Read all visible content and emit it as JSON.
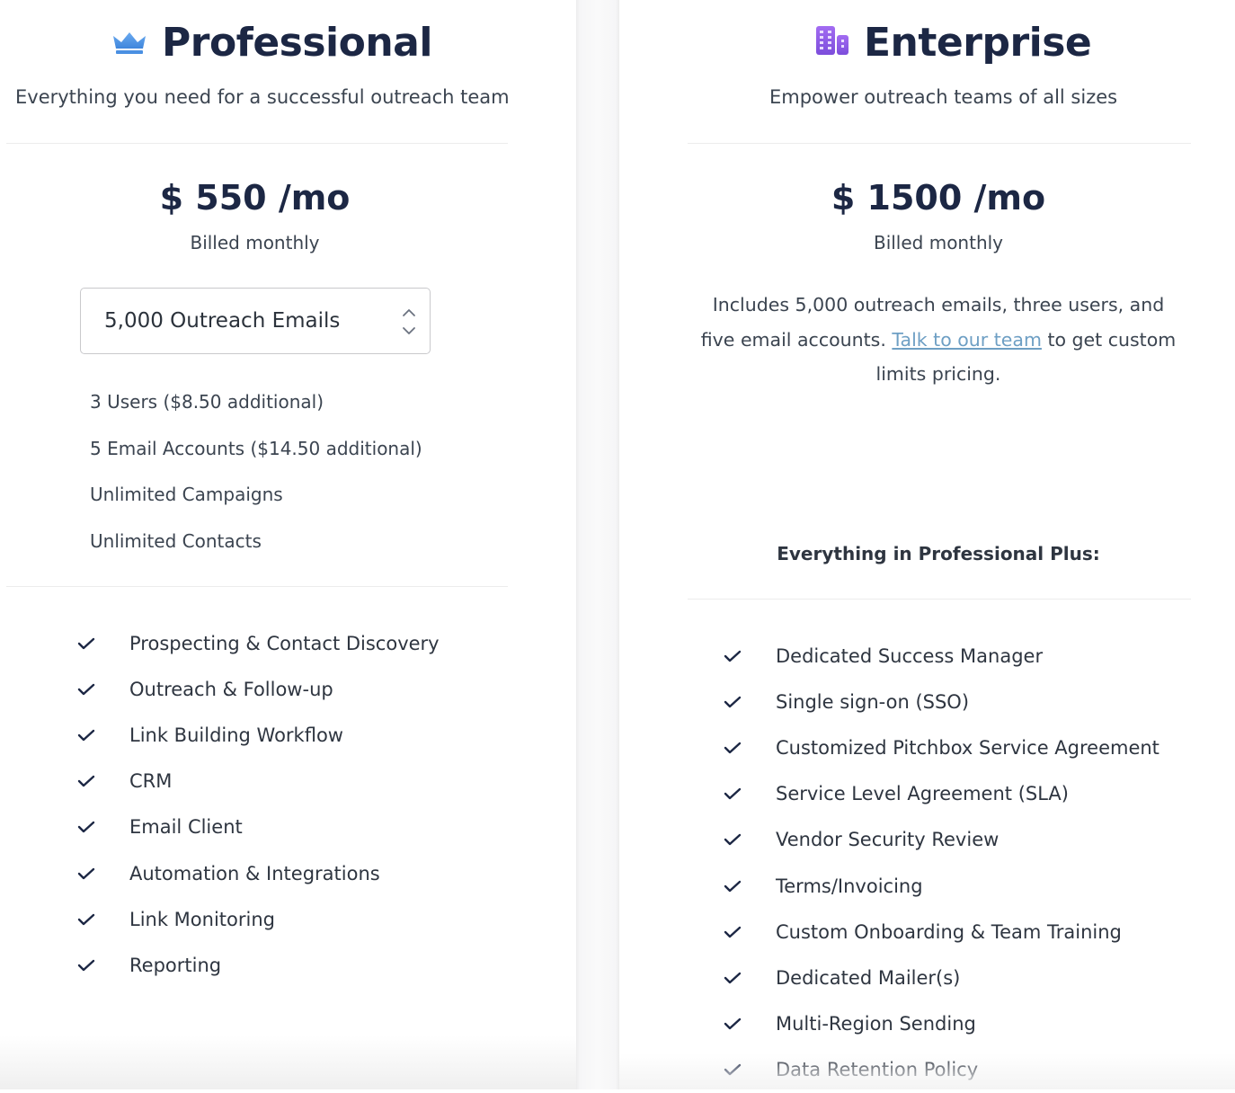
{
  "professional": {
    "icon": "crown-icon",
    "title": "Professional",
    "subtitle": "Everything you need for a successful outreach team",
    "price": "$ 550 /mo",
    "billing": "Billed monthly",
    "email_select": {
      "selected": "5,000 Outreach Emails"
    },
    "limits": [
      "3 Users ($8.50 additional)",
      "5 Email Accounts ($14.50 additional)",
      "Unlimited Campaigns",
      "Unlimited Contacts"
    ],
    "features": [
      "Prospecting & Contact Discovery",
      "Outreach & Follow-up",
      "Link Building Workflow",
      "CRM",
      "Email Client",
      "Automation & Integrations",
      "Link Monitoring",
      "Reporting"
    ]
  },
  "enterprise": {
    "icon": "building-icon",
    "title": "Enterprise",
    "subtitle": "Empower outreach teams of all sizes",
    "price": "$ 1500 /mo",
    "billing": "Billed monthly",
    "description": {
      "before_link": "Includes 5,000 outreach emails, three users, and five email accounts. ",
      "link_text": "Talk to our team",
      "after_link": " to get custom limits pricing."
    },
    "plus_heading": "Everything in Professional Plus:",
    "features": [
      "Dedicated Success Manager",
      "Single sign-on (SSO)",
      "Customized Pitchbox Service Agreement",
      "Service Level Agreement (SLA)",
      "Vendor Security Review",
      "Terms/Invoicing",
      "Custom Onboarding & Team Training",
      "Dedicated Mailer(s)",
      "Multi-Region Sending",
      "Data Retention Policy"
    ]
  },
  "colors": {
    "heading": "#1c2744",
    "body_text": "#3b4450",
    "link": "#6e9fc4",
    "crown": "#4a90e2",
    "building": "#8b5cf6"
  }
}
